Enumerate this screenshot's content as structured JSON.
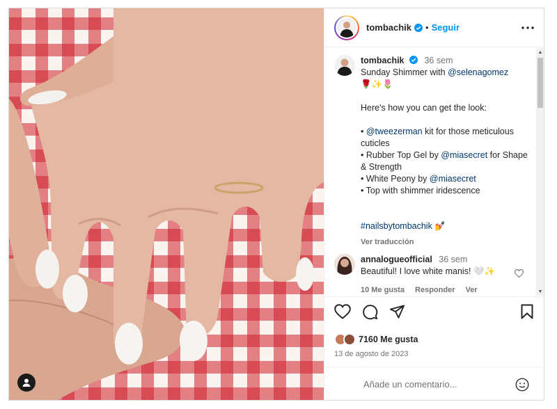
{
  "post": {
    "username": "tombachik",
    "follow_label": "Seguir",
    "dot": "•"
  },
  "caption": {
    "username": "tombachik",
    "time": "36 sem",
    "line1_text": "Sunday Shimmer with ",
    "line1_mention": "@selenagomez",
    "emojis": "🌹✨🌷",
    "intro": "Here's how you can get the look:",
    "b1_prefix": "• ",
    "b1_mention": "@tweezerman",
    "b1_text": " kit for those meticulous cuticles",
    "b2_text": "• Rubber Top Gel by ",
    "b2_mention": "@miasecret",
    "b2_suffix": " for Shape & Strength",
    "b3_text": "• White Peony by ",
    "b3_mention": "@miasecret",
    "b4_text": "• Top with shimmer iridescence",
    "hashtag": "#nailsbytombachik",
    "hashtag_emoji": "💅",
    "translate": "Ver traducción"
  },
  "comment": {
    "username": "annalogueofficial",
    "time": "36 sem",
    "text": "Beautiful! I love white manis! 🤍✨",
    "likes": "10 Me gusta",
    "reply": "Responder",
    "translate": "Ver traducción"
  },
  "engagement": {
    "likes": "7160 Me gusta",
    "date": "13 de agosto de 2023"
  },
  "add_comment": {
    "placeholder": "Añade un comentario..."
  },
  "colors": {
    "accent": "#0095f6",
    "link": "#00376b",
    "muted": "#737373",
    "gingham_red": "#ce222c"
  },
  "icons": [
    "verified-icon",
    "more-icon",
    "heart-icon",
    "comment-icon",
    "share-icon",
    "bookmark-icon",
    "emoji-icon",
    "user-tag-icon"
  ]
}
